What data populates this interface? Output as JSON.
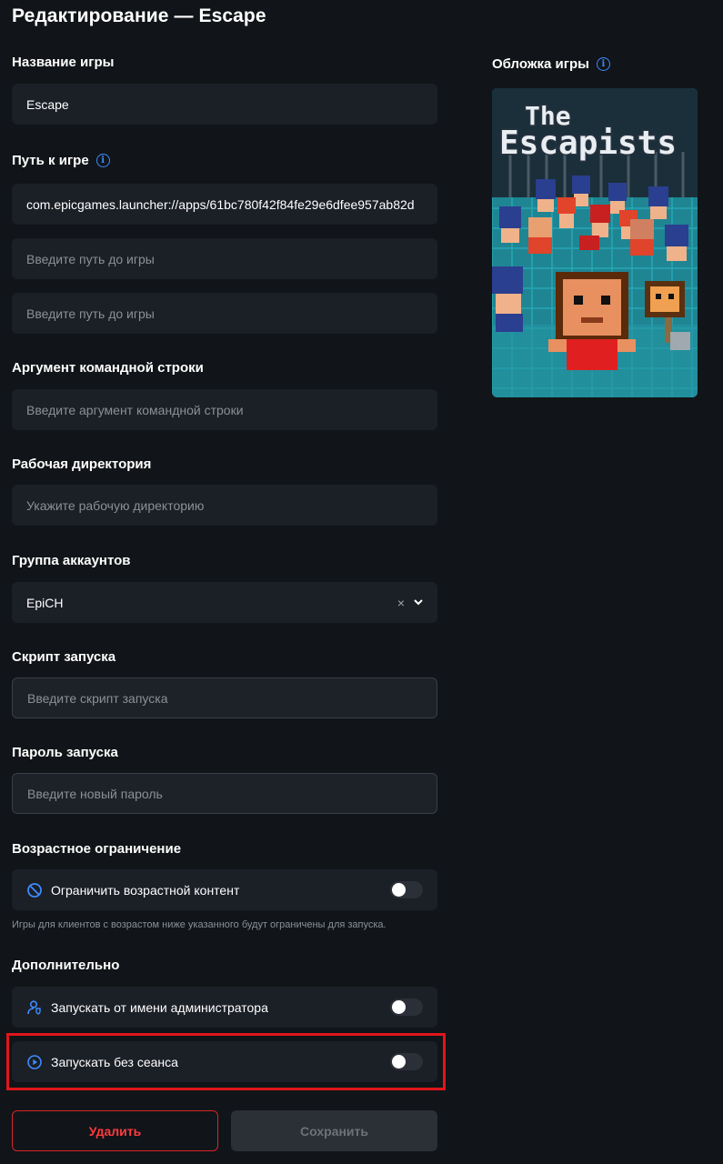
{
  "title": "Редактирование — Escape",
  "fields": {
    "name": {
      "label": "Название игры",
      "value": "Escape"
    },
    "path": {
      "label": "Путь к игре",
      "value1": "com.epicgames.launcher://apps/61bc780f42f84fe29e6dfee957ab82d",
      "placeholder2": "Введите путь до игры",
      "placeholder3": "Введите путь до игры"
    },
    "args": {
      "label": "Аргумент командной строки",
      "placeholder": "Введите аргумент командной строки"
    },
    "workdir": {
      "label": "Рабочая директория",
      "placeholder": "Укажите рабочую директорию"
    },
    "group": {
      "label": "Группа аккаунтов",
      "value": "EpiCH",
      "clear": "×",
      "chevron": "⌄"
    },
    "script": {
      "label": "Скрипт запуска",
      "placeholder": "Введите скрипт запуска"
    },
    "password": {
      "label": "Пароль запуска",
      "placeholder": "Введите новый пароль"
    }
  },
  "age": {
    "label": "Возрастное ограничение",
    "toggle_label": "Ограничить возрастной контент",
    "toggle_on": false,
    "hint": "Игры для клиентов с возрастом ниже указанного  будут ограничены для запуска."
  },
  "extra": {
    "label": "Дополнительно",
    "admin_label": "Запускать от имени администратора",
    "admin_on": false,
    "nosession_label": "Запускать без сеанса",
    "nosession_on": false
  },
  "buttons": {
    "delete": "Удалить",
    "save": "Сохранить"
  },
  "cover": {
    "label": "Обложка игры",
    "logo_line1": "The",
    "logo_line2": "Escapists"
  },
  "colors": {
    "accent": "#3d8bff",
    "danger": "#e0161b",
    "bg": "#111418",
    "field": "#1b1f26"
  },
  "icons": {
    "info": "info-icon",
    "age": "no-entry-icon",
    "admin": "user-shield-icon",
    "session": "play-circle-icon"
  }
}
